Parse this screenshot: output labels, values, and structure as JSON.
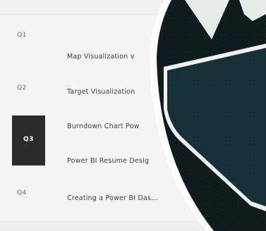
{
  "quarters": [
    {
      "label": "Q1"
    },
    {
      "label": "Q2"
    },
    {
      "label": "Q3",
      "active": true
    },
    {
      "label": "Q4"
    }
  ],
  "items": [
    {
      "title": "Map Visualization v"
    },
    {
      "title": "Target Visualization"
    },
    {
      "title": "Burndown Chart Pow"
    },
    {
      "title": "Power BI Resume Desig"
    },
    {
      "title": "Creating a Power BI Das..."
    }
  ],
  "colors": {
    "active_background": "#2b2b2b",
    "artwork_dark": "#0f1b1d",
    "artwork_panel": "#173038",
    "artwork_accent": "#e6ece8"
  },
  "icons": {
    "artwork": "dark-cover-artwork"
  }
}
